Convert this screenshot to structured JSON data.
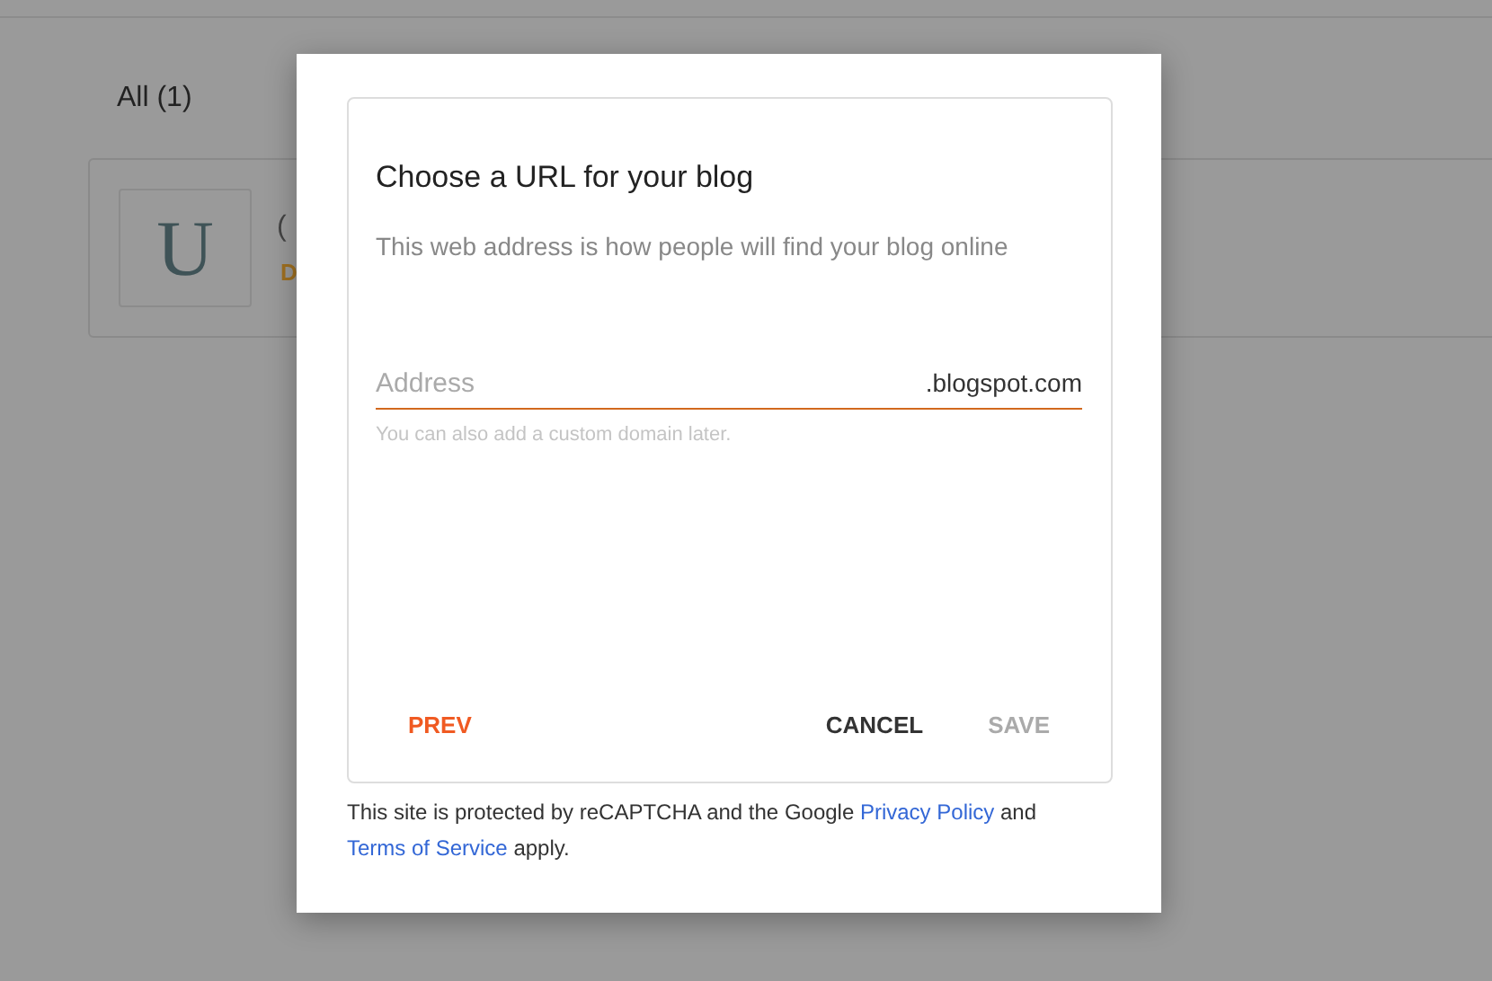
{
  "background": {
    "filter_tab": {
      "label": "All (1)"
    },
    "blog_card": {
      "avatar_letter": "U",
      "title": "(",
      "status": "D"
    }
  },
  "dialog": {
    "title": "Choose a URL for your blog",
    "description": "This web address is how people will find your blog online",
    "address_field": {
      "placeholder": "Address",
      "suffix": ".blogspot.com",
      "helper": "You can also add a custom domain later."
    },
    "buttons": [
      {
        "label": "PREV",
        "kind": "accent",
        "disabled": false
      },
      {
        "label": "CANCEL",
        "kind": "plain",
        "disabled": false
      },
      {
        "label": "SAVE",
        "kind": "plain",
        "disabled": true
      }
    ],
    "footer": [
      {
        "text": "This site is protected by reCAPTCHA and the Google ",
        "link": false
      },
      {
        "text": "Privacy Policy",
        "link": true
      },
      {
        "text": " and ",
        "link": false
      },
      {
        "text": "Terms of Service",
        "link": true
      },
      {
        "text": " apply.",
        "link": false
      }
    ]
  }
}
